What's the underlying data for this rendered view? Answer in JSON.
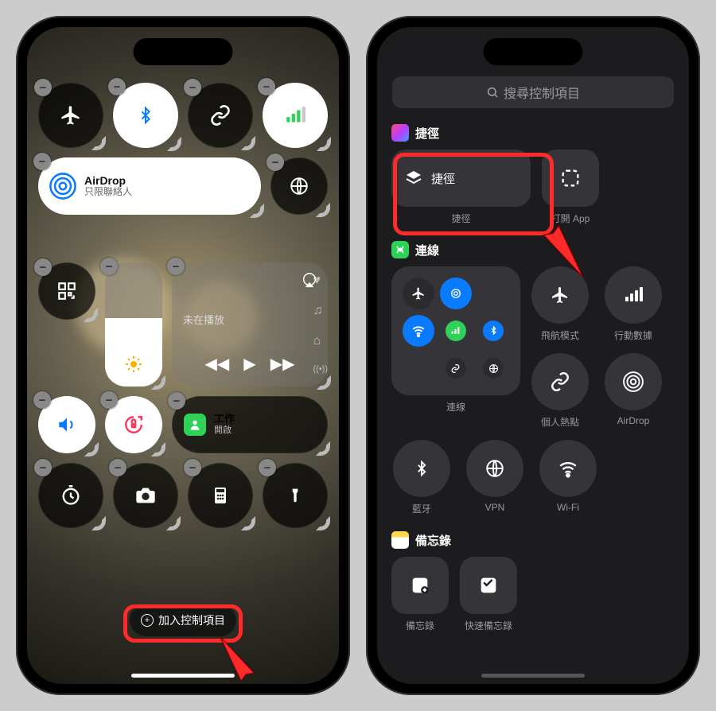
{
  "left": {
    "airdrop_title": "AirDrop",
    "airdrop_sub": "只限聯絡人",
    "media_status": "未在播放",
    "focus_label": "工作",
    "focus_state": "開啟",
    "add_control": "加入控制項目",
    "controls": [
      {
        "name": "airplane",
        "icon": "airplane",
        "style": "dark"
      },
      {
        "name": "bluetooth",
        "icon": "bluetooth",
        "style": "light"
      },
      {
        "name": "hotspot",
        "icon": "hotspot",
        "style": "dark"
      },
      {
        "name": "cellular",
        "icon": "bars",
        "style": "light"
      }
    ],
    "vpn_icon": "globe",
    "qr_icon": "qr",
    "rotate_icon": "rotation-lock",
    "timer_icon": "timer",
    "camera_icon": "camera",
    "calc_icon": "calculator",
    "flash_icon": "flashlight"
  },
  "right": {
    "search_placeholder": "搜尋控制項目",
    "shortcuts_section": "捷徑",
    "shortcut_btn": "捷徑",
    "shortcut_lbl": "捷徑",
    "open_app_lbl": "打開 App",
    "connection_section": "連線",
    "conn_lbl": "連線",
    "airplane_lbl": "飛航模式",
    "cellular_lbl": "行動數據",
    "hotspot_lbl": "個人熱點",
    "airdrop_lbl": "AirDrop",
    "bluetooth_lbl": "藍牙",
    "vpn_lbl": "VPN",
    "wifi_lbl": "Wi-Fi",
    "notes_section": "備忘錄",
    "notes_lbl": "備忘錄",
    "quicknote_lbl": "快速備忘錄"
  }
}
